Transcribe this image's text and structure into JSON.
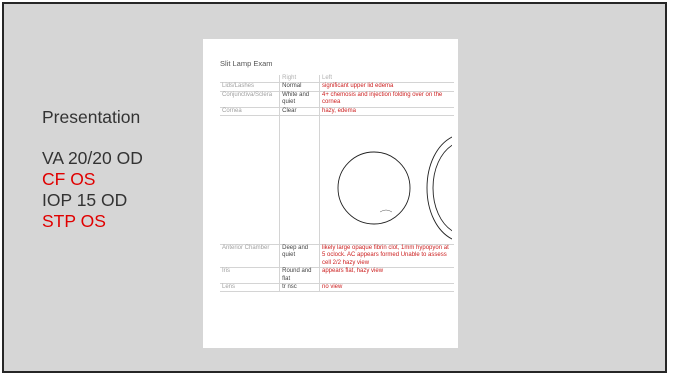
{
  "presentation": {
    "heading": "Presentation",
    "lines": [
      {
        "text": "VA 20/20 OD",
        "color": "#333333"
      },
      {
        "text": "CF OS",
        "color": "#e00000"
      },
      {
        "text": "IOP 15 OD",
        "color": "#333333"
      },
      {
        "text": "STP OS",
        "color": "#e00000"
      }
    ]
  },
  "exam": {
    "title": "Slit Lamp Exam",
    "col_right": "Right",
    "col_left": "Left",
    "rows": [
      {
        "label": "Lids/Lashes",
        "right": "Normal",
        "left": "significant upper lid edema"
      },
      {
        "label": "Conjunctiva/Sclera",
        "right": "White and quiet",
        "left": "4+ chemosis and injection folding over on the cornea"
      },
      {
        "label": "Cornea",
        "right": "Clear",
        "left": "hazy, edema"
      },
      {
        "label": "Anterior Chamber",
        "right": "Deep and quiet",
        "left": "likely large opaque fibrin clot, 1mm hypopyon at 5 oclock. AC appears formed Unable to assess cell 2/2 hazy view"
      },
      {
        "label": "Iris",
        "right": "Round and flat",
        "left": "appears flat, hazy view"
      },
      {
        "label": "Lens",
        "right": "tr nsc",
        "left": "no view"
      }
    ]
  }
}
